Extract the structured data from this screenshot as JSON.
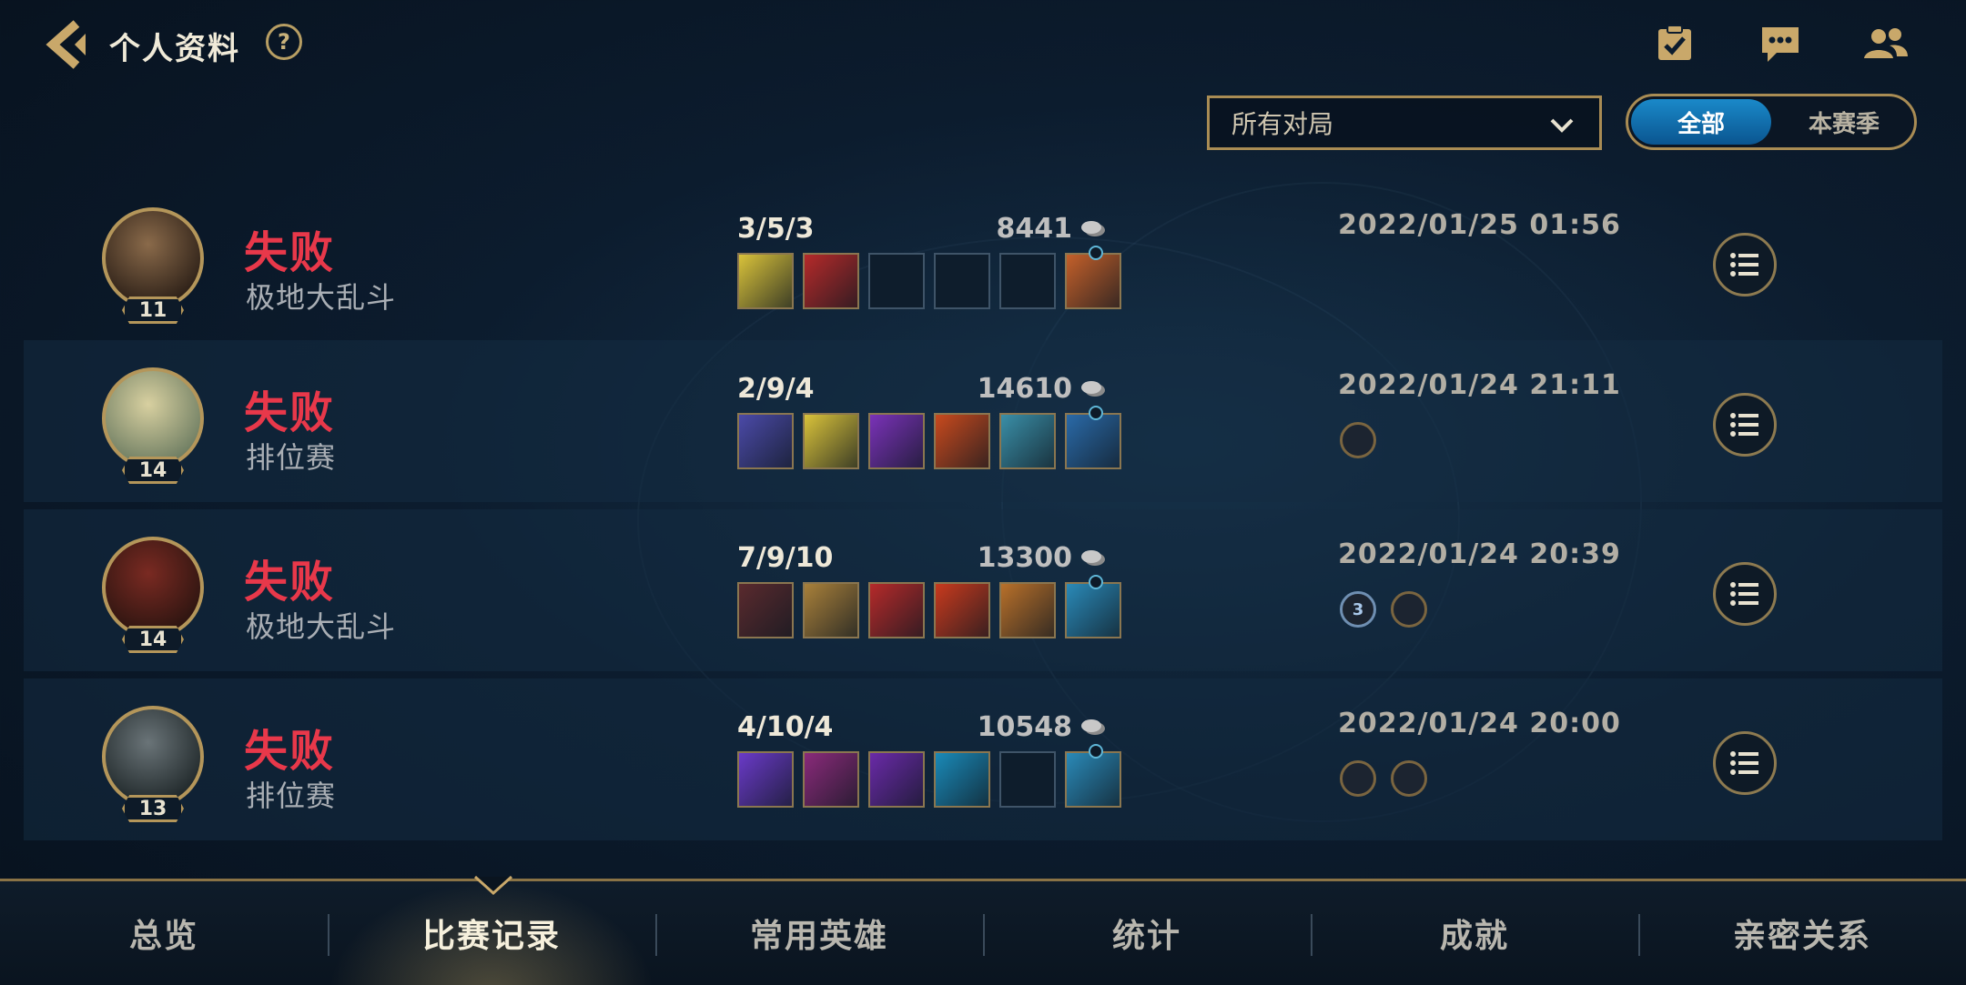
{
  "header": {
    "title": "个人资料",
    "help_label": "?"
  },
  "filters": {
    "match_type_selected": "所有对局",
    "scope_options": [
      "全部",
      "本赛季"
    ],
    "scope_selected": "全部"
  },
  "matches": [
    {
      "result": "失败",
      "mode": "极地大乱斗",
      "level": "11",
      "kda": "3/5/3",
      "gold": "8441",
      "datetime": "2022/01/25 01:56",
      "items": [
        "#d9c23a",
        "#b52a2a",
        "",
        "",
        "",
        "#c4602a"
      ],
      "badges": []
    },
    {
      "result": "失败",
      "mode": "排位赛",
      "level": "14",
      "kda": "2/9/4",
      "gold": "14610",
      "datetime": "2022/01/24 21:11",
      "items": [
        "#4b4aa8",
        "#d9c23a",
        "#7a32b8",
        "#c84a1e",
        "#3a8fa8",
        "#2a6aa8"
      ],
      "badges": [
        {
          "icon": "trophy-badge-icon",
          "text": "",
          "color": "gold"
        }
      ]
    },
    {
      "result": "失败",
      "mode": "极地大乱斗",
      "level": "14",
      "kda": "7/9/10",
      "gold": "13300",
      "datetime": "2022/01/24 20:39",
      "items": [
        "#5a2a2e",
        "#a8803a",
        "#b52a2a",
        "#c83a1e",
        "#b8702a",
        "#2a8ab8"
      ],
      "badges": [
        {
          "icon": "triple-kill-badge-icon",
          "text": "3",
          "color": "blue"
        },
        {
          "icon": "blood-badge-icon",
          "text": "",
          "color": "gold"
        }
      ]
    },
    {
      "result": "失败",
      "mode": "排位赛",
      "level": "13",
      "kda": "4/10/4",
      "gold": "10548",
      "datetime": "2022/01/24 20:00",
      "items": [
        "#6a3ac8",
        "#8a2a7a",
        "#6a2aa8",
        "#1a8ab8",
        "",
        "#2a8ab8"
      ],
      "badges": [
        {
          "icon": "laurel-badge-icon",
          "text": "",
          "color": "gold"
        },
        {
          "icon": "shield-badge-icon",
          "text": "",
          "color": "gold"
        }
      ]
    }
  ],
  "bottom_nav": [
    {
      "label": "总览",
      "active": false
    },
    {
      "label": "比赛记录",
      "active": true
    },
    {
      "label": "常用英雄",
      "active": false
    },
    {
      "label": "统计",
      "active": false
    },
    {
      "label": "成就",
      "active": false
    },
    {
      "label": "亲密关系",
      "active": false
    }
  ],
  "colors": {
    "loss": "#e8384a",
    "gold_border": "#a98c54",
    "active_blue": "#1a89c9"
  }
}
